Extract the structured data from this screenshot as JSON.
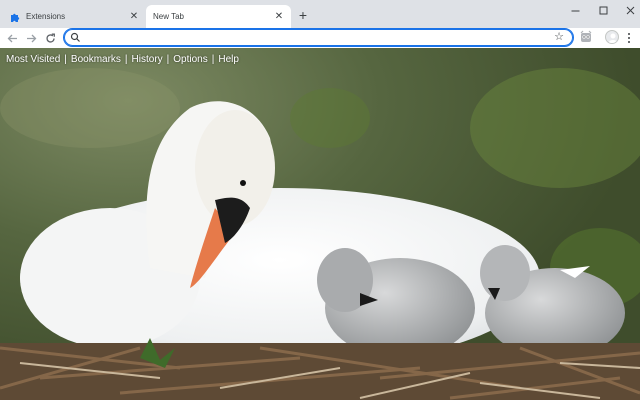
{
  "tabs": [
    {
      "label": "Extensions",
      "icon": "puzzle-icon",
      "active": false
    },
    {
      "label": "New Tab",
      "active": true
    }
  ],
  "omnibox": {
    "value": "",
    "placeholder": ""
  },
  "newtab": {
    "links": [
      "Most Visited",
      "Bookmarks",
      "History",
      "Options",
      "Help"
    ],
    "separator": "|",
    "background": "photo of a white swan resting on a nest with grey cygnets"
  },
  "colors": {
    "focus": "#1a73e8",
    "tabstrip": "#dee1e6",
    "extension_icon": "#1a73e8"
  }
}
